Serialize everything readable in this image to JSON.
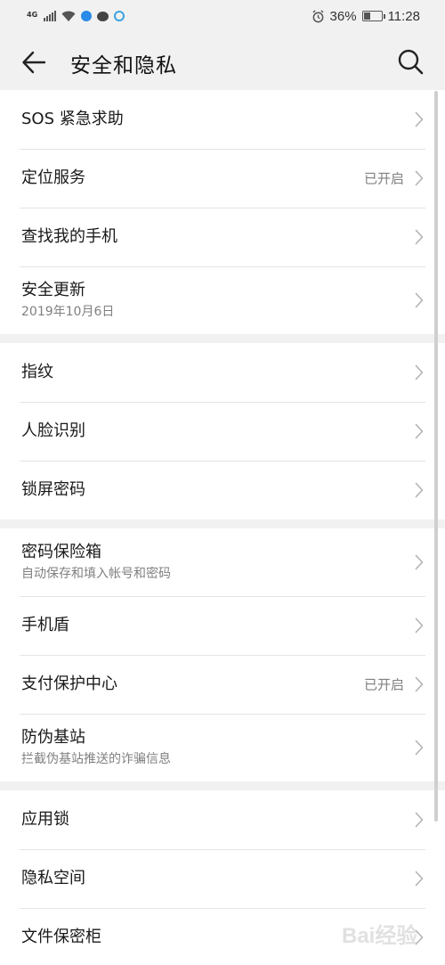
{
  "status_bar": {
    "network": "4G",
    "alarm_icon": "alarm-icon",
    "battery_percent": "36%",
    "battery_level": 0.36,
    "time": "11:28"
  },
  "header": {
    "title": "安全和隐私",
    "back_icon": "arrow-left-icon",
    "search_icon": "search-icon"
  },
  "groups": [
    [
      {
        "title": "SOS 紧急求助"
      },
      {
        "title": "定位服务",
        "status": "已开启"
      },
      {
        "title": "查找我的手机"
      },
      {
        "title": "安全更新",
        "subtitle": "2019年10月6日"
      }
    ],
    [
      {
        "title": "指纹"
      },
      {
        "title": "人脸识别"
      },
      {
        "title": "锁屏密码"
      }
    ],
    [
      {
        "title": "密码保险箱",
        "subtitle": "自动保存和填入帐号和密码"
      },
      {
        "title": "手机盾"
      },
      {
        "title": "支付保护中心",
        "status": "已开启"
      },
      {
        "title": "防伪基站",
        "subtitle": "拦截伪基站推送的诈骗信息"
      }
    ],
    [
      {
        "title": "应用锁"
      },
      {
        "title": "隐私空间"
      },
      {
        "title": "文件保密柜"
      }
    ]
  ],
  "watermark": "Bai经验",
  "colors": {
    "background": "#f1f1f1",
    "card": "#ffffff",
    "secondary_text": "#808080"
  }
}
